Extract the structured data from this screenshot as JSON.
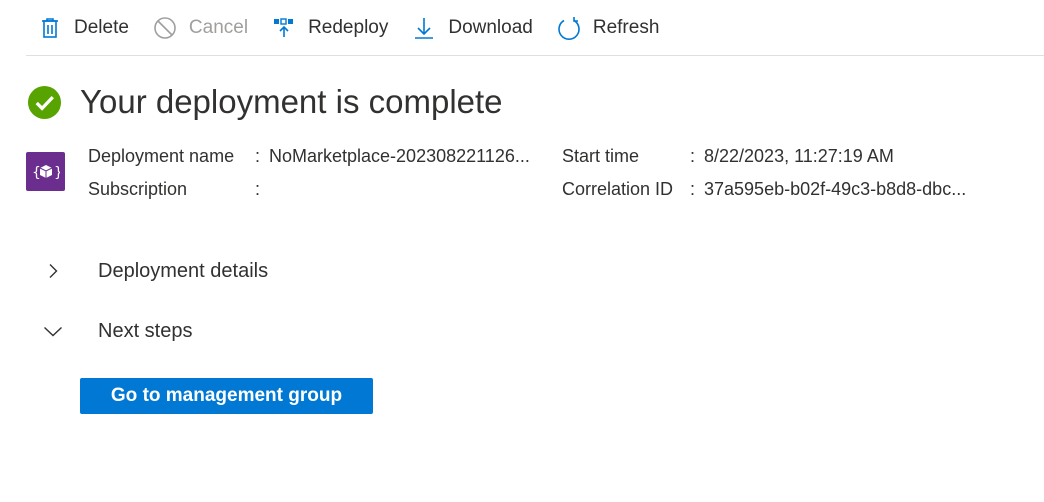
{
  "toolbar": {
    "delete_label": "Delete",
    "cancel_label": "Cancel",
    "redeploy_label": "Redeploy",
    "download_label": "Download",
    "refresh_label": "Refresh"
  },
  "header": {
    "title": "Your deployment is complete",
    "status_icon": "success-check-icon",
    "status_color": "#57a300"
  },
  "summary": {
    "resource_icon": "deployment-cube-icon",
    "deployment_name_label": "Deployment name",
    "deployment_name_value": "NoMarketplace-202308221126...",
    "subscription_label": "Subscription",
    "subscription_value": "",
    "start_time_label": "Start time",
    "start_time_value": "8/22/2023, 11:27:19 AM",
    "correlation_id_label": "Correlation ID",
    "correlation_id_value": "37a595eb-b02f-49c3-b8d8-dbc...",
    "separator": ":"
  },
  "sections": {
    "deployment_details": "Deployment details",
    "next_steps": "Next steps"
  },
  "actions": {
    "primary_label": "Go to management group"
  },
  "colors": {
    "accent": "#0078d4",
    "resource_icon_bg": "#6b2d8e"
  }
}
